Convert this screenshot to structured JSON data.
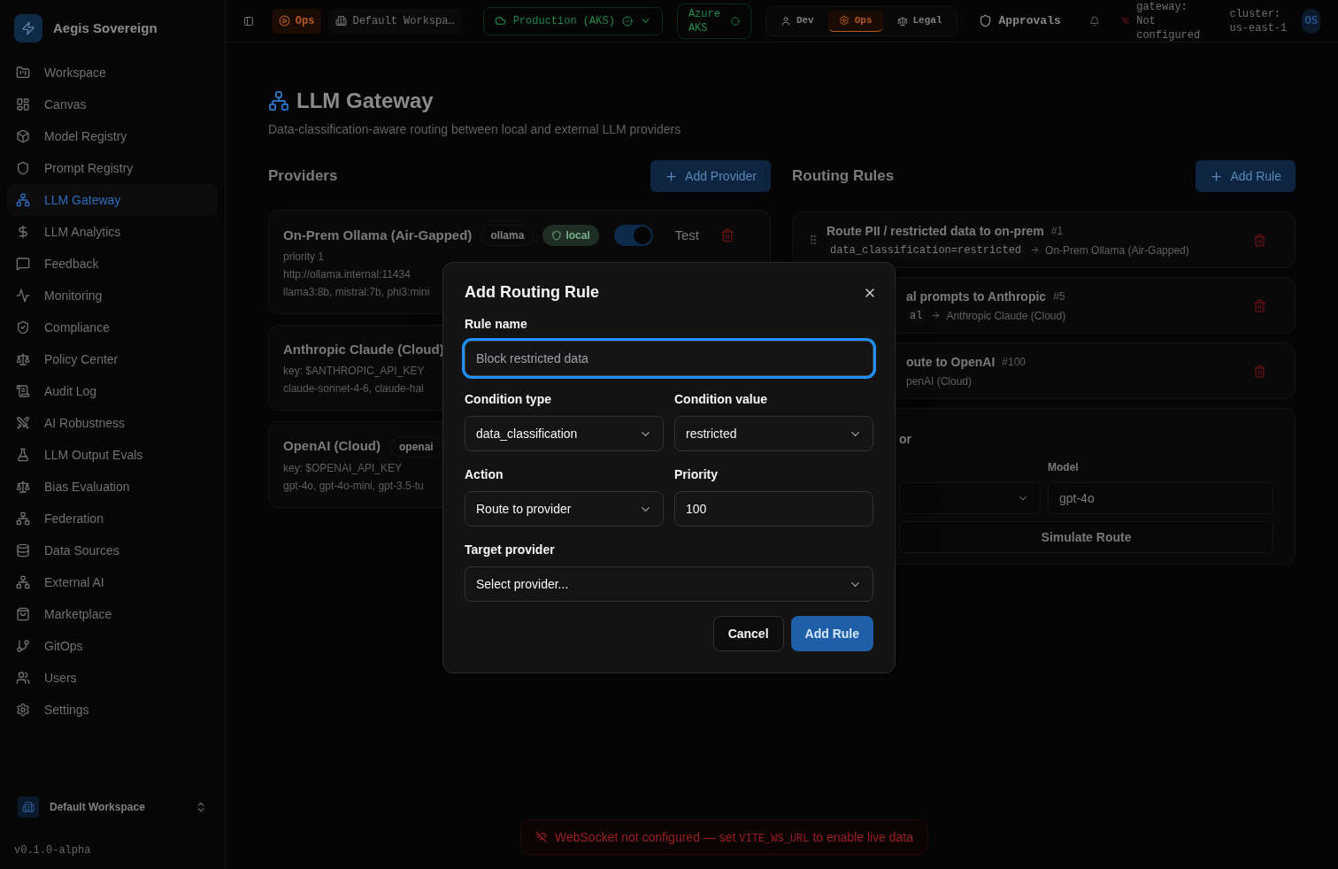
{
  "app": {
    "name": "Aegis Sovereign",
    "version": "v0.1.0-alpha"
  },
  "sidebar": {
    "items": [
      {
        "label": "Workspace",
        "selected": false
      },
      {
        "label": "Canvas",
        "selected": false
      },
      {
        "label": "Model Registry",
        "selected": false
      },
      {
        "label": "Prompt Registry",
        "selected": false
      },
      {
        "label": "LLM Gateway",
        "selected": true
      },
      {
        "label": "LLM Analytics",
        "selected": false
      },
      {
        "label": "Feedback",
        "selected": false
      },
      {
        "label": "Monitoring",
        "selected": false
      },
      {
        "label": "Compliance",
        "selected": false
      },
      {
        "label": "Policy Center",
        "selected": false
      },
      {
        "label": "Audit Log",
        "selected": false
      },
      {
        "label": "AI Robustness",
        "selected": false
      },
      {
        "label": "LLM Output Evals",
        "selected": false
      },
      {
        "label": "Bias Evaluation",
        "selected": false
      },
      {
        "label": "Federation",
        "selected": false
      },
      {
        "label": "Data Sources",
        "selected": false
      },
      {
        "label": "External AI",
        "selected": false
      },
      {
        "label": "Marketplace",
        "selected": false
      },
      {
        "label": "GitOps",
        "selected": false
      },
      {
        "label": "Users",
        "selected": false
      },
      {
        "label": "Settings",
        "selected": false
      }
    ],
    "workspace": "Default Workspace"
  },
  "header": {
    "role_badge": "Ops",
    "workspace": "Default Workspa…",
    "environment": "Production (AKS)",
    "cluster_badge": "Azure AKS",
    "roles": [
      {
        "label": "Dev",
        "selected": false
      },
      {
        "label": "Ops",
        "selected": true
      },
      {
        "label": "Legal",
        "selected": false
      }
    ],
    "approvals": "Approvals",
    "gateway": "gateway: Not configured",
    "cluster": "cluster: us-east-1",
    "avatar": "OS"
  },
  "page": {
    "title": "LLM Gateway",
    "subtitle": "Data-classification-aware routing between local and external LLM providers"
  },
  "providers": {
    "heading": "Providers",
    "add_button": "Add Provider",
    "items": [
      {
        "name": "On-Prem Ollama (Air-Gapped)",
        "badges": [
          {
            "label": "ollama",
            "kind": "tag"
          },
          {
            "label": "local",
            "kind": "local"
          }
        ],
        "lines": [
          "priority 1",
          "http://ollama.internal:11434",
          "llama3:8b, mistral:7b, phi3:mini"
        ],
        "controls": {
          "enabled": true,
          "test_label": "Test"
        }
      },
      {
        "name": "Anthropic Claude (Cloud)",
        "lines": [
          "key: $ANTHROPIC_API_KEY",
          "claude-sonnet-4-6, claude-hai"
        ]
      },
      {
        "name": "OpenAI (Cloud)",
        "badges": [
          {
            "label": "openai",
            "kind": "tag"
          }
        ],
        "lines": [
          "key: $OPENAI_API_KEY",
          "gpt-4o, gpt-4o-mini, gpt-3.5-tu"
        ]
      }
    ]
  },
  "rules": {
    "heading": "Routing Rules",
    "add_button": "Add Rule",
    "items": [
      {
        "name": "Route PII / restricted data to on-prem",
        "priority": "#1",
        "condition": "data_classification=restricted",
        "target": "On-Prem Ollama (Air-Gapped)"
      },
      {
        "name": "al prompts to Anthropic",
        "priority": "#5",
        "condition": "al",
        "target": "Anthropic Claude (Cloud)"
      },
      {
        "name": "oute to OpenAI",
        "priority": "#100",
        "target": "penAI (Cloud)"
      }
    ]
  },
  "simulator": {
    "heading": "or",
    "model_label": "Model",
    "model_value": "gpt-4o",
    "button": "Simulate Route"
  },
  "toast": {
    "before": "WebSocket not configured — set ",
    "code": "VITE_WS_URL",
    "after": " to enable live data"
  },
  "modal": {
    "title": "Add Routing Rule",
    "fields": [
      {
        "label": "Rule name",
        "kind": "input",
        "placeholder": "Block restricted data",
        "focused": true
      },
      {
        "label": "Condition type",
        "kind": "select",
        "value": "data_classification"
      },
      {
        "label": "Condition value",
        "kind": "select",
        "value": "restricted"
      },
      {
        "label": "Action",
        "kind": "select",
        "value": "Route to provider"
      },
      {
        "label": "Priority",
        "kind": "input",
        "value": "100",
        "focused": false
      },
      {
        "label": "Target provider",
        "kind": "select",
        "value": "Select provider..."
      }
    ],
    "buttons": [
      {
        "label": "Cancel",
        "kind": "secondary"
      },
      {
        "label": "Add Rule",
        "kind": "primary"
      }
    ]
  }
}
